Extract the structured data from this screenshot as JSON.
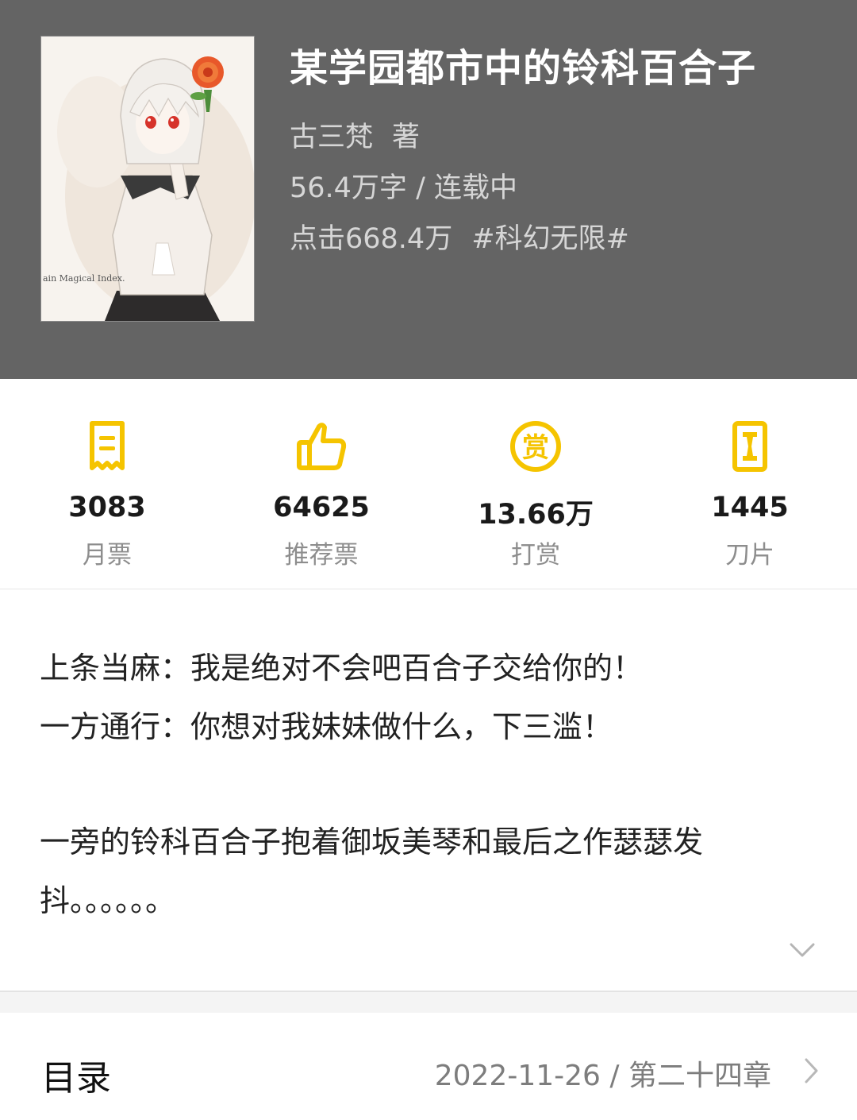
{
  "book": {
    "title": "某学园都市中的铃科百合子",
    "author": "古三梵",
    "author_suffix": "著",
    "words": "56.4万字",
    "status": "连载中",
    "clicks": "点击668.4万",
    "tag": "#科幻无限#",
    "cover_text": "ain Magical Index."
  },
  "stats": [
    {
      "icon": "monthly-ticket-icon",
      "value": "3083",
      "label": "月票"
    },
    {
      "icon": "thumbs-up-icon",
      "value": "64625",
      "label": "推荐票"
    },
    {
      "icon": "reward-coin-icon",
      "value": "13.66万",
      "label": "打赏"
    },
    {
      "icon": "blade-icon",
      "value": "1445",
      "label": "刀片"
    }
  ],
  "intro": {
    "line1": "上条当麻：我是绝对不会吧百合子交给你的！",
    "line2": "一方通行：你想对我妹妹做什么，下三滥！",
    "line3": "一旁的铃科百合子抱着御坂美琴和最后之作瑟瑟发抖。。。。。。"
  },
  "catalog": {
    "title": "目录",
    "date": "2022-11-26",
    "separator": "/",
    "chapter": "第二十四章"
  },
  "colors": {
    "header_bg": "#646464",
    "accent": "#F5C400"
  }
}
